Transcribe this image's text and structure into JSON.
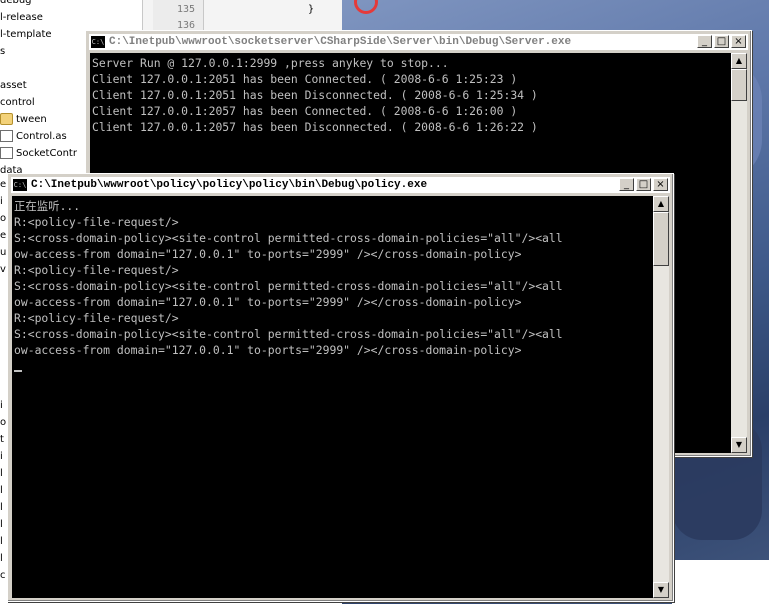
{
  "explorer": {
    "items": [
      {
        "label": "debug",
        "icon": "none"
      },
      {
        "label": "l-release",
        "icon": "none"
      },
      {
        "label": "l-template",
        "icon": "none"
      },
      {
        "label": "s",
        "icon": "none"
      },
      {
        "label": "asset",
        "icon": "none"
      },
      {
        "label": "control",
        "icon": "none"
      },
      {
        "label": "tween",
        "icon": "folder-icon"
      },
      {
        "label": "Control.as",
        "icon": "file-icon"
      },
      {
        "label": "SocketContr",
        "icon": "file-icon"
      },
      {
        "label": "data",
        "icon": "none"
      }
    ]
  },
  "editor": {
    "line_numbers": [
      "135",
      "136"
    ],
    "code_line": "}"
  },
  "server_window": {
    "title": "C:\\Inetpub\\wwwroot\\socketserver\\CSharpSide\\Server\\bin\\Debug\\Server.exe",
    "icon_text": "C:\\",
    "buttons": {
      "minimize": "_",
      "maximize": "□",
      "close": "×"
    },
    "lines": [
      "Server Run @ 127.0.0.1:2999 ,press anykey to stop...",
      "Client 127.0.0.1:2051 has been Connected. ( 2008-6-6 1:25:23 )",
      "Client 127.0.0.1:2051 has been Disconnected. ( 2008-6-6 1:25:34 )",
      "Client 127.0.0.1:2057 has been Connected. ( 2008-6-6 1:26:00 )",
      "Client 127.0.0.1:2057 has been Disconnected. ( 2008-6-6 1:26:22 )"
    ]
  },
  "policy_window": {
    "title": "C:\\Inetpub\\wwwroot\\policy\\policy\\policy\\bin\\Debug\\policy.exe",
    "icon_text": "C:\\",
    "buttons": {
      "minimize": "_",
      "maximize": "□",
      "close": "×"
    },
    "lines": [
      "正在监听...",
      "R:<policy-file-request/>",
      "S:<cross-domain-policy><site-control permitted-cross-domain-policies=\"all\"/><all",
      "ow-access-from domain=\"127.0.0.1\" to-ports=\"2999\" /></cross-domain-policy>",
      "R:<policy-file-request/>",
      "S:<cross-domain-policy><site-control permitted-cross-domain-policies=\"all\"/><all",
      "ow-access-from domain=\"127.0.0.1\" to-ports=\"2999\" /></cross-domain-policy>",
      "R:<policy-file-request/>",
      "S:<cross-domain-policy><site-control permitted-cross-domain-policies=\"all\"/><all",
      "ow-access-from domain=\"127.0.0.1\" to-ports=\"2999\" /></cross-domain-policy>"
    ]
  },
  "left_strip_chars": [
    "e",
    "i",
    "o",
    "e",
    "u",
    "v",
    "",
    "",
    "",
    "",
    "",
    "",
    "",
    "i",
    "o",
    "t",
    "i",
    "l",
    "l",
    "l",
    "l",
    "l",
    "l",
    "c"
  ],
  "scroll_arrows": {
    "up": "▲",
    "down": "▼"
  }
}
